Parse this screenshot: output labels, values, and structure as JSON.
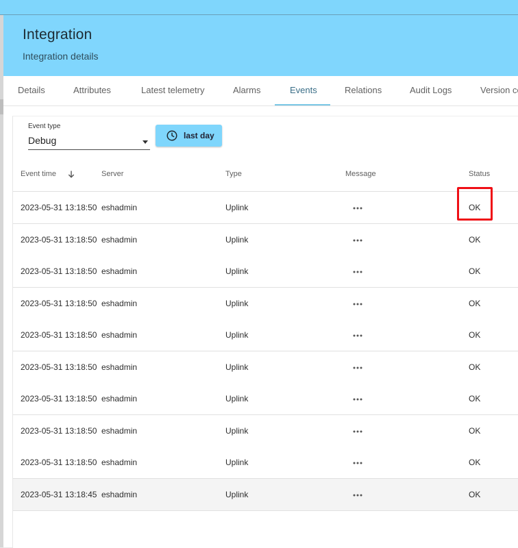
{
  "header": {
    "title": "Integration",
    "subtitle": "Integration details"
  },
  "tabs": [
    {
      "label": "Details"
    },
    {
      "label": "Attributes"
    },
    {
      "label": "Latest telemetry"
    },
    {
      "label": "Alarms"
    },
    {
      "label": "Events",
      "active": true
    },
    {
      "label": "Relations"
    },
    {
      "label": "Audit Logs"
    },
    {
      "label": "Version co"
    }
  ],
  "filters": {
    "event_type_label": "Event type",
    "event_type_value": "Debug",
    "time_button_label": "last day",
    "time_icon": "clock-icon"
  },
  "table": {
    "columns": [
      "Event time",
      "Server",
      "Type",
      "Message",
      "Status"
    ],
    "sort_icon": "arrow-down-icon",
    "message_icon": "more-horizontal-icon",
    "rows": [
      {
        "time": "2023-05-31 13:18:50",
        "server": "eshadmin",
        "type": "Uplink",
        "status": "OK"
      },
      {
        "time": "2023-05-31 13:18:50",
        "server": "eshadmin",
        "type": "Uplink",
        "status": "OK"
      },
      {
        "time": "2023-05-31 13:18:50",
        "server": "eshadmin",
        "type": "Uplink",
        "status": "OK"
      },
      {
        "time": "2023-05-31 13:18:50",
        "server": "eshadmin",
        "type": "Uplink",
        "status": "OK"
      },
      {
        "time": "2023-05-31 13:18:50",
        "server": "eshadmin",
        "type": "Uplink",
        "status": "OK"
      },
      {
        "time": "2023-05-31 13:18:50",
        "server": "eshadmin",
        "type": "Uplink",
        "status": "OK"
      },
      {
        "time": "2023-05-31 13:18:50",
        "server": "eshadmin",
        "type": "Uplink",
        "status": "OK"
      },
      {
        "time": "2023-05-31 13:18:50",
        "server": "eshadmin",
        "type": "Uplink",
        "status": "OK"
      },
      {
        "time": "2023-05-31 13:18:50",
        "server": "eshadmin",
        "type": "Uplink",
        "status": "OK"
      },
      {
        "time": "2023-05-31 13:18:45",
        "server": "eshadmin",
        "type": "Uplink",
        "status": "OK"
      }
    ]
  },
  "colors": {
    "header_bg": "#80d6fd",
    "accent": "#7fd6fc",
    "highlight": "#ef0f16"
  }
}
